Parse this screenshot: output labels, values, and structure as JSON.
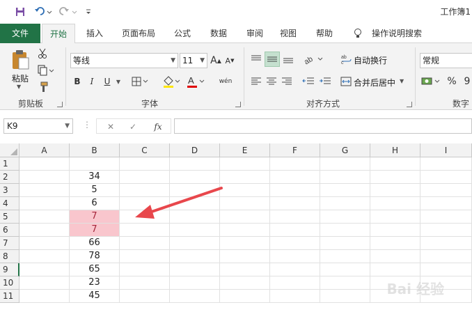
{
  "qat": {
    "title": "工作簿1"
  },
  "tabs": [
    "文件",
    "开始",
    "插入",
    "页面布局",
    "公式",
    "数据",
    "审阅",
    "视图",
    "帮助"
  ],
  "tell_me": "操作说明搜索",
  "ribbon": {
    "clipboard": {
      "paste_label": "粘贴",
      "group_label": "剪贴板"
    },
    "font": {
      "font_name": "等线",
      "font_size": "11",
      "group_label": "字体",
      "bold": "B",
      "italic": "I",
      "underline": "U",
      "grow": "A",
      "shrink": "A",
      "color_a": "A",
      "phonetic": "wén"
    },
    "alignment": {
      "wrap_text": "自动换行",
      "merge_center": "合并后居中",
      "group_label": "对齐方式"
    },
    "number": {
      "format": "常规",
      "percent": "%",
      "comma": "9",
      "group_label": "数字"
    }
  },
  "formula_bar": {
    "name_box": "K9",
    "fx": "fx",
    "cancel": "✕",
    "enter": "✓",
    "value": ""
  },
  "grid": {
    "columns": [
      "A",
      "B",
      "C",
      "D",
      "E",
      "F",
      "G",
      "H",
      "I"
    ],
    "rows": [
      "1",
      "2",
      "3",
      "4",
      "5",
      "6",
      "7",
      "8",
      "9",
      "10",
      "11"
    ],
    "column_b_values": [
      "",
      "34",
      "5",
      "6",
      "7",
      "7",
      "66",
      "78",
      "65",
      "23",
      "45"
    ],
    "highlighted_rows": [
      "5",
      "6"
    ],
    "highlight_color": "#f9c6cd",
    "selected_row": "9"
  },
  "colors": {
    "accent": "#217346",
    "arrow": "#e8474c"
  },
  "watermark": "Bai 经验"
}
